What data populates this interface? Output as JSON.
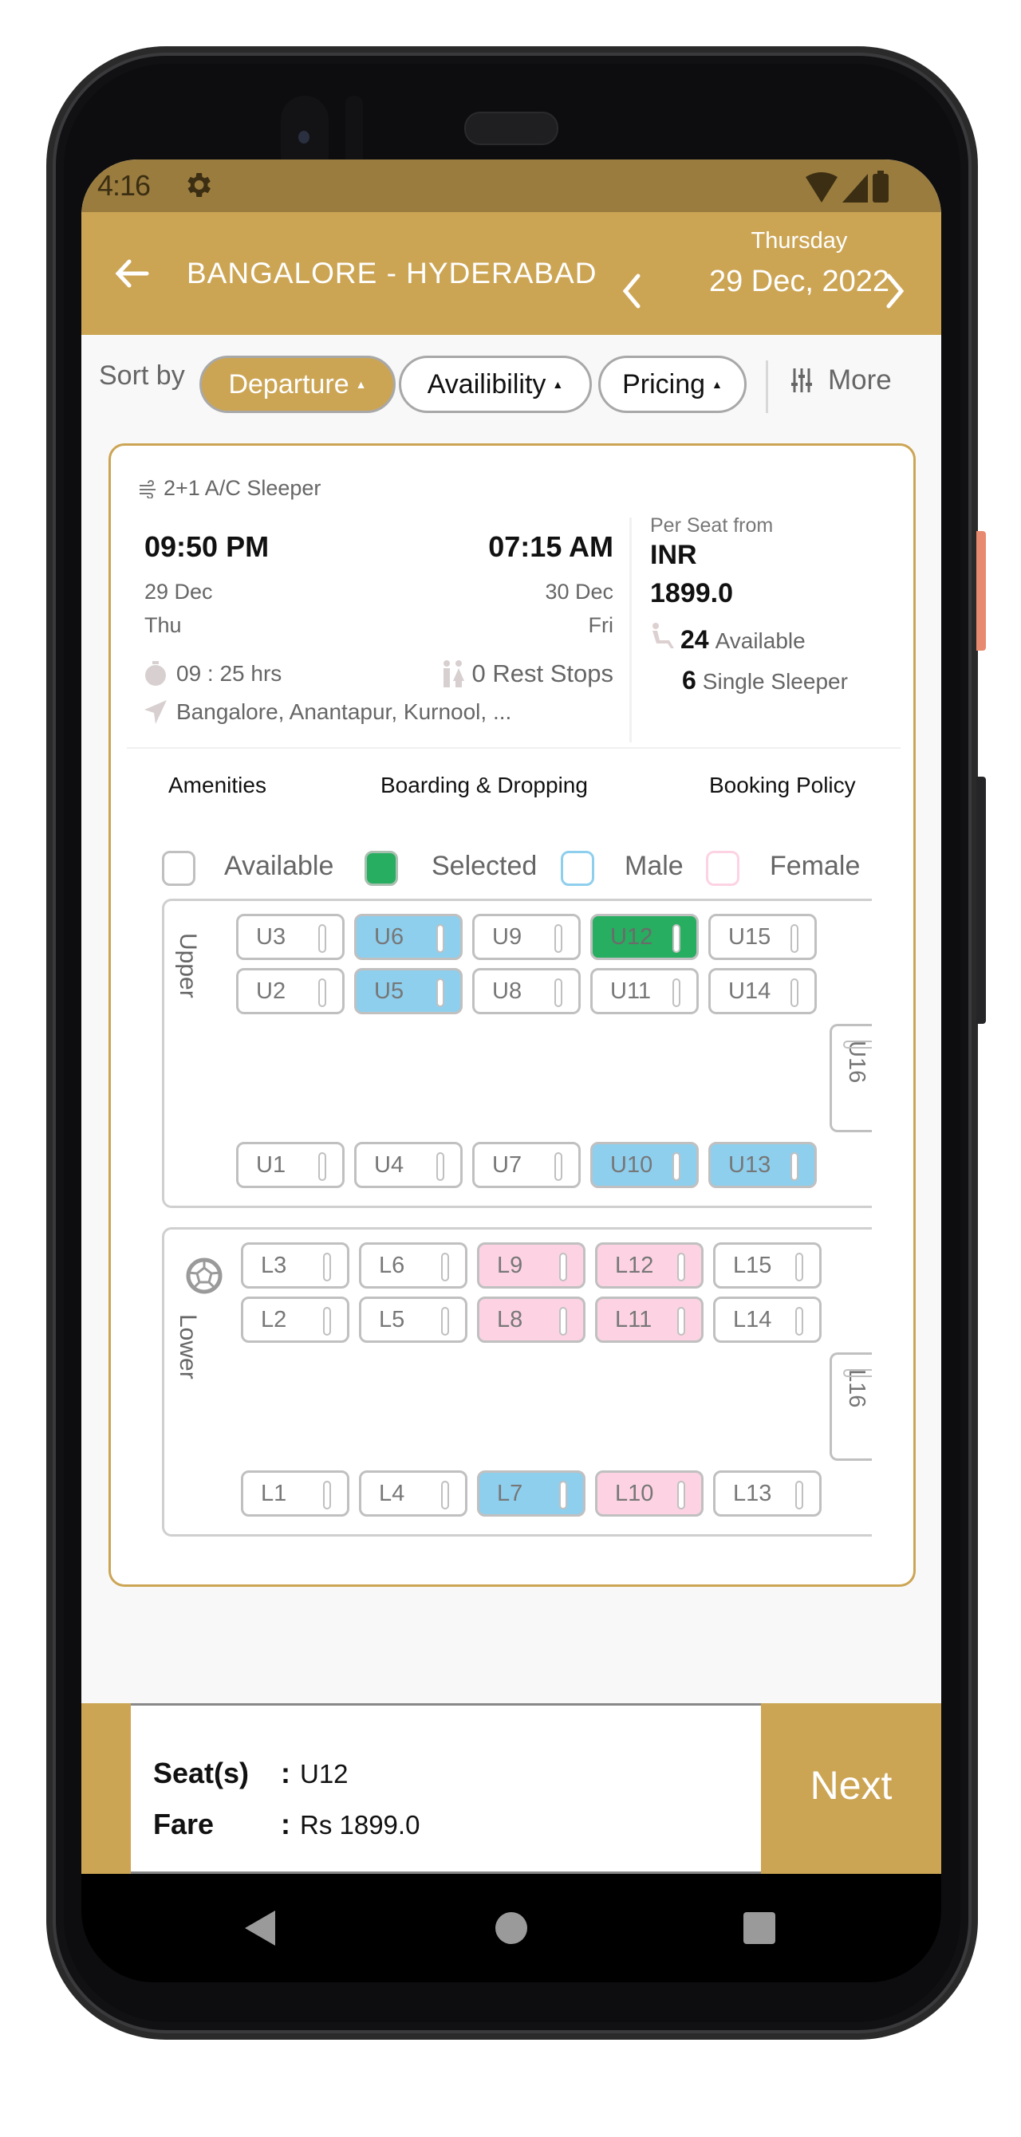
{
  "status_bar": {
    "time": "4:16",
    "icons": [
      "gear-icon",
      "wifi-icon",
      "signal-icon",
      "battery-icon"
    ]
  },
  "header": {
    "route": "BANGALORE - HYDERABAD",
    "day": "Thursday",
    "date": "29 Dec, 2022",
    "accent_color": "#cca554"
  },
  "sort": {
    "label": "Sort by",
    "options": [
      {
        "label": "Departure",
        "active": true
      },
      {
        "label": "Availibility",
        "active": false
      },
      {
        "label": "Pricing",
        "active": false
      }
    ],
    "arrow": "▲",
    "more_label": "More"
  },
  "bus": {
    "type": "2+1 A/C Sleeper",
    "departure": {
      "time": "09:50 PM",
      "date": "29 Dec",
      "day": "Thu"
    },
    "arrival": {
      "time": "07:15 AM",
      "date": "30 Dec",
      "day": "Fri"
    },
    "duration": "09 : 25 hrs",
    "rest_stops": "0 Rest Stops",
    "via": "Bangalore, Anantapur, Kurnool, ...",
    "per_seat_label": "Per Seat from",
    "currency": "INR",
    "price": "1899.0",
    "available_count": "24",
    "available_label": "Available",
    "single_count": "6",
    "single_label": "Single Sleeper"
  },
  "tabs": [
    "Amenities",
    "Boarding & Dropping",
    "Booking Policy"
  ],
  "legend": [
    {
      "label": "Available",
      "color": "#ffffff"
    },
    {
      "label": "Selected",
      "color": "#27ae60"
    },
    {
      "label": "Male",
      "color": "#8ecfee"
    },
    {
      "label": "Female",
      "color": "#fdd3e3"
    }
  ],
  "decks": {
    "upper": {
      "label": "Upper",
      "row_top": [
        {
          "id": "U3",
          "status": "available"
        },
        {
          "id": "U6",
          "status": "male"
        },
        {
          "id": "U9",
          "status": "available"
        },
        {
          "id": "U12",
          "status": "selected"
        },
        {
          "id": "U15",
          "status": "available"
        }
      ],
      "row_mid": [
        {
          "id": "U2",
          "status": "available"
        },
        {
          "id": "U5",
          "status": "male"
        },
        {
          "id": "U8",
          "status": "available"
        },
        {
          "id": "U11",
          "status": "available"
        },
        {
          "id": "U14",
          "status": "available"
        }
      ],
      "row_bottom": [
        {
          "id": "U1",
          "status": "available"
        },
        {
          "id": "U4",
          "status": "available"
        },
        {
          "id": "U7",
          "status": "available"
        },
        {
          "id": "U10",
          "status": "male"
        },
        {
          "id": "U13",
          "status": "male"
        }
      ],
      "rear": {
        "id": "U16",
        "status": "available"
      }
    },
    "lower": {
      "label": "Lower",
      "row_top": [
        {
          "id": "L3",
          "status": "available"
        },
        {
          "id": "L6",
          "status": "available"
        },
        {
          "id": "L9",
          "status": "female"
        },
        {
          "id": "L12",
          "status": "female"
        },
        {
          "id": "L15",
          "status": "available"
        }
      ],
      "row_mid": [
        {
          "id": "L2",
          "status": "available"
        },
        {
          "id": "L5",
          "status": "available"
        },
        {
          "id": "L8",
          "status": "female"
        },
        {
          "id": "L11",
          "status": "female"
        },
        {
          "id": "L14",
          "status": "available"
        }
      ],
      "row_bottom": [
        {
          "id": "L1",
          "status": "available"
        },
        {
          "id": "L4",
          "status": "available"
        },
        {
          "id": "L7",
          "status": "male"
        },
        {
          "id": "L10",
          "status": "female"
        },
        {
          "id": "L13",
          "status": "available"
        }
      ],
      "rear": {
        "id": "L16",
        "status": "available"
      }
    }
  },
  "summary": {
    "seats_label": "Seat(s)",
    "seats_value": "U12",
    "fare_label": "Fare",
    "fare_value": "Rs 1899.0",
    "next_label": "Next"
  }
}
